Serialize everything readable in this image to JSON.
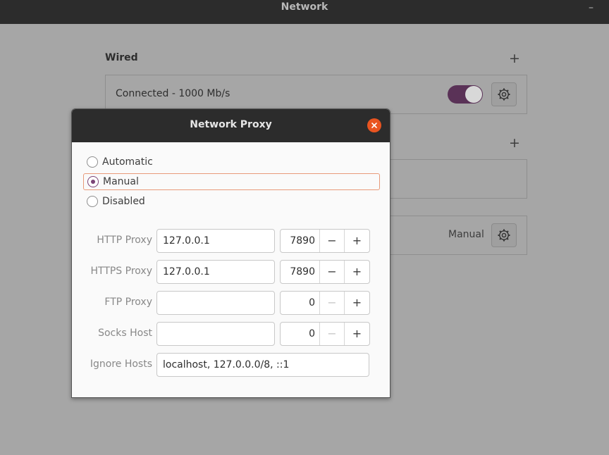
{
  "window": {
    "title": "Network",
    "minimize": "–"
  },
  "background": {
    "wired_title": "Wired",
    "add_symbol": "+",
    "wired_status": "Connected - 1000 Mb/s",
    "wired_enabled": true,
    "proxy_status": "Manual"
  },
  "dialog": {
    "title": "Network Proxy",
    "modes": [
      {
        "label": "Automatic",
        "selected": false
      },
      {
        "label": "Manual",
        "selected": true
      },
      {
        "label": "Disabled",
        "selected": false
      }
    ],
    "rows": [
      {
        "label": "HTTP Proxy",
        "host": "127.0.0.1",
        "port": "7890"
      },
      {
        "label": "HTTPS Proxy",
        "host": "127.0.0.1",
        "port": "7890"
      },
      {
        "label": "FTP Proxy",
        "host": "",
        "port": "0"
      },
      {
        "label": "Socks Host",
        "host": "",
        "port": "0"
      }
    ],
    "ignore_hosts": {
      "label": "Ignore Hosts",
      "value": "localhost, 127.0.0.0/8, ::1"
    },
    "minus_symbol": "−",
    "plus_symbol": "+"
  },
  "colors": {
    "accent": "#7b4477",
    "close": "#e95420",
    "titlebar": "#2c2c2c"
  }
}
